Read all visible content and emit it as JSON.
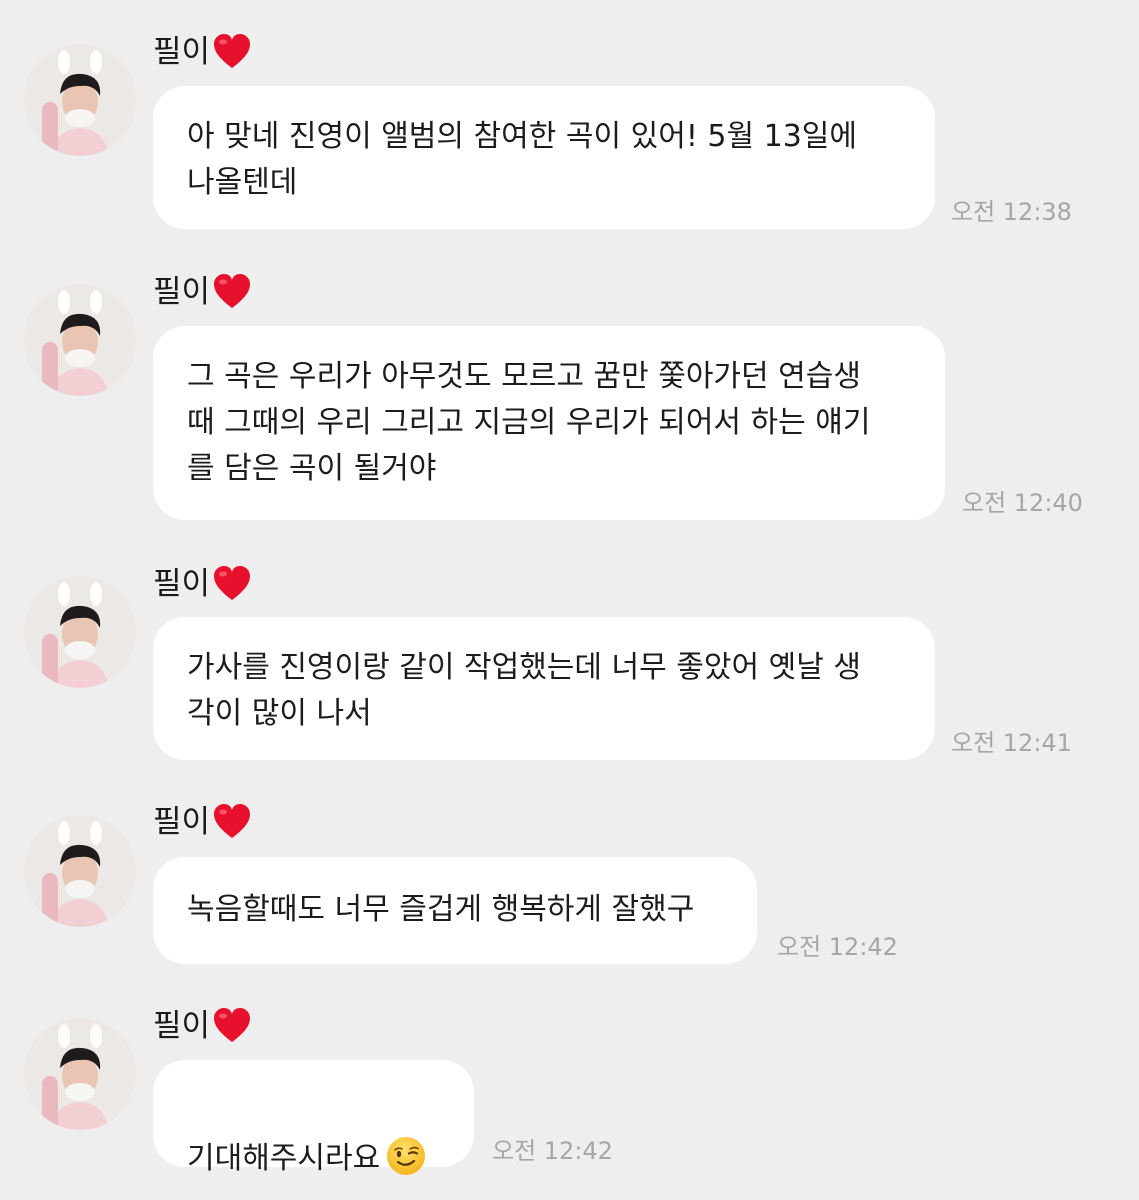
{
  "sender_name": "필이",
  "messages": [
    {
      "text": "아 맞네 진영이 앨범의 참여한 곡이 있어! 5월 13일에\n나올텐데",
      "time": "오전 12:38"
    },
    {
      "text": "그 곡은 우리가 아무것도 모르고 꿈만 쫓아가던 연습생\n때 그때의 우리 그리고 지금의 우리가 되어서 하는 얘기\n를 담은 곡이 될거야",
      "time": "오전 12:40"
    },
    {
      "text": "가사를 진영이랑 같이 작업했는데 너무 좋았어 옛날 생\n각이 많이 나서",
      "time": "오전 12:41"
    },
    {
      "text": "녹음할때도 너무 즐겁게 행복하게 잘했구",
      "time": "오전 12:42"
    },
    {
      "text": "기대해주시라요",
      "time": "오전 12:42",
      "emoji": "winking-face-emoji"
    }
  ],
  "icons": {
    "heart": "red-heart-icon",
    "avatar": "profile-photo"
  },
  "colors": {
    "background": "#eeeeee",
    "bubble": "#ffffff",
    "time_text": "#a6a6a6",
    "heart": "#e8112d"
  }
}
